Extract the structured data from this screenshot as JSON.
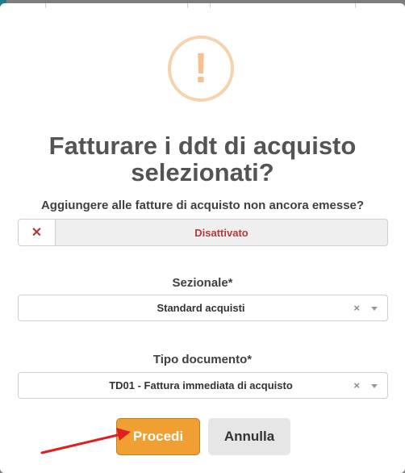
{
  "dialog": {
    "icon": "exclamation-icon",
    "icon_glyph": "!",
    "title": "Fatturare i ddt di acquisto selezionati?",
    "add_question": "Aggiungere alle fatture di acquisto non ancora emesse?",
    "toggle": {
      "icon": "close-icon",
      "glyph": "✕",
      "state_label": "Disattivato"
    },
    "sezionale": {
      "label": "Sezionale*",
      "value": "Standard acquisti",
      "clear_glyph": "×"
    },
    "tipo_documento": {
      "label": "Tipo documento*",
      "value": "TD01 - Fattura immediata di acquisto",
      "clear_glyph": "×"
    },
    "buttons": {
      "confirm": "Procedi",
      "cancel": "Annulla"
    }
  },
  "colors": {
    "accent": "#f0a032",
    "warning_ring": "#f6d2ad",
    "disabled_text": "#b23b3b",
    "annotation_arrow": "#e02020"
  }
}
